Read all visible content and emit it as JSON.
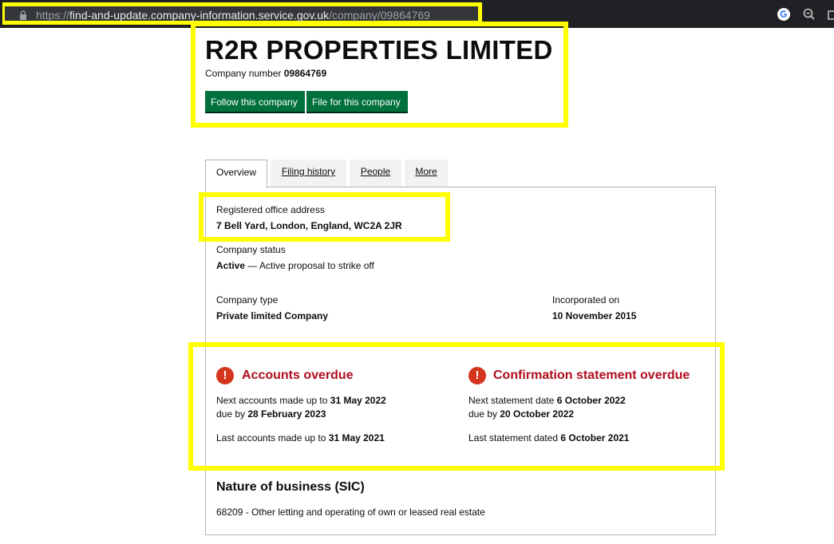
{
  "browser": {
    "url_scheme": "https://",
    "url_host": "find-and-update.company-information.service.gov.uk",
    "url_path": "/company/09864769"
  },
  "header": {
    "company_name": "R2R PROPERTIES LIMITED",
    "company_number_label": "Company number",
    "company_number": "09864769",
    "follow_button": "Follow this company",
    "file_button": "File for this company"
  },
  "tabs": [
    {
      "label": "Overview",
      "active": true
    },
    {
      "label": "Filing history",
      "active": false
    },
    {
      "label": "People",
      "active": false
    },
    {
      "label": "More",
      "active": false
    }
  ],
  "overview": {
    "registered_office_label": "Registered office address",
    "registered_office_value": "7 Bell Yard, London, England, WC2A 2JR",
    "status_label": "Company status",
    "status_value": "Active",
    "status_detail": " — Active proposal to strike off",
    "type_label": "Company type",
    "type_value": "Private limited Company",
    "incorporated_label": "Incorporated on",
    "incorporated_value": "10 November 2015"
  },
  "accounts": {
    "title": "Accounts overdue",
    "next_label": "Next accounts made up to",
    "next_value": "31 May 2022",
    "due_label": "due by",
    "due_value": "28 February 2023",
    "last_label": "Last accounts made up to",
    "last_value": "31 May 2021"
  },
  "confirmation": {
    "title": "Confirmation statement overdue",
    "next_label": "Next statement date",
    "next_value": "6 October 2022",
    "due_label": "due by",
    "due_value": "20 October 2022",
    "last_label": "Last statement dated",
    "last_value": "6 October 2021"
  },
  "warning_icon_glyph": "!",
  "nature": {
    "heading": "Nature of business (SIC)",
    "sic": "68209 - Other letting and operating of own or leased real estate"
  },
  "colors": {
    "highlight": "#ffff00",
    "button_green": "#00703c",
    "overdue_red": "#b10e1e",
    "warning_red": "#d4351c"
  },
  "icons": [
    "lock-icon",
    "google-icon",
    "zoom-icon",
    "share-icon",
    "warning-icon"
  ]
}
